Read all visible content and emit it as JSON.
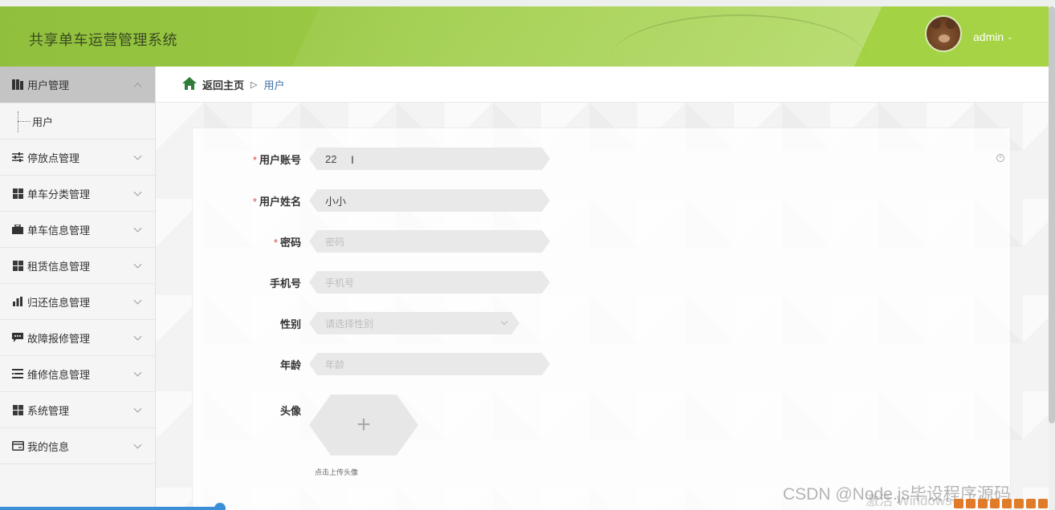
{
  "app": {
    "title": "共享单车运营管理系统"
  },
  "user": {
    "name": "admin"
  },
  "sidebar": {
    "items": [
      {
        "label": "用户管理",
        "icon": "book-icon",
        "expanded": true,
        "children": [
          {
            "label": "用户"
          }
        ]
      },
      {
        "label": "停放点管理",
        "icon": "sliders-icon"
      },
      {
        "label": "单车分类管理",
        "icon": "grid-icon"
      },
      {
        "label": "单车信息管理",
        "icon": "briefcase-icon"
      },
      {
        "label": "租赁信息管理",
        "icon": "grid-icon"
      },
      {
        "label": "归还信息管理",
        "icon": "bar-chart-icon"
      },
      {
        "label": "故障报修管理",
        "icon": "comment-icon"
      },
      {
        "label": "维修信息管理",
        "icon": "list-icon"
      },
      {
        "label": "系统管理",
        "icon": "grid-icon"
      },
      {
        "label": "我的信息",
        "icon": "card-icon"
      }
    ]
  },
  "breadcrumb": {
    "home": "返回主页",
    "separator": "▷",
    "current": "用户"
  },
  "form": {
    "account": {
      "label": "用户账号",
      "value": "22"
    },
    "name": {
      "label": "用户姓名",
      "value": "小小"
    },
    "password": {
      "label": "密码",
      "placeholder": "密码"
    },
    "phone": {
      "label": "手机号",
      "placeholder": "手机号"
    },
    "gender": {
      "label": "性别",
      "placeholder": "请选择性别"
    },
    "age": {
      "label": "年龄",
      "placeholder": "年龄"
    },
    "avatar": {
      "label": "头像",
      "upload_tip": "点击上传头像",
      "plus": "+"
    }
  },
  "overlay": {
    "csdn_watermark": "CSDN @Node.js毕设程序源码",
    "windows_watermark": "激活 Windows"
  },
  "colors": {
    "header": "#9ccc45",
    "required": "#e04a4a",
    "link": "#3c6fa8"
  }
}
